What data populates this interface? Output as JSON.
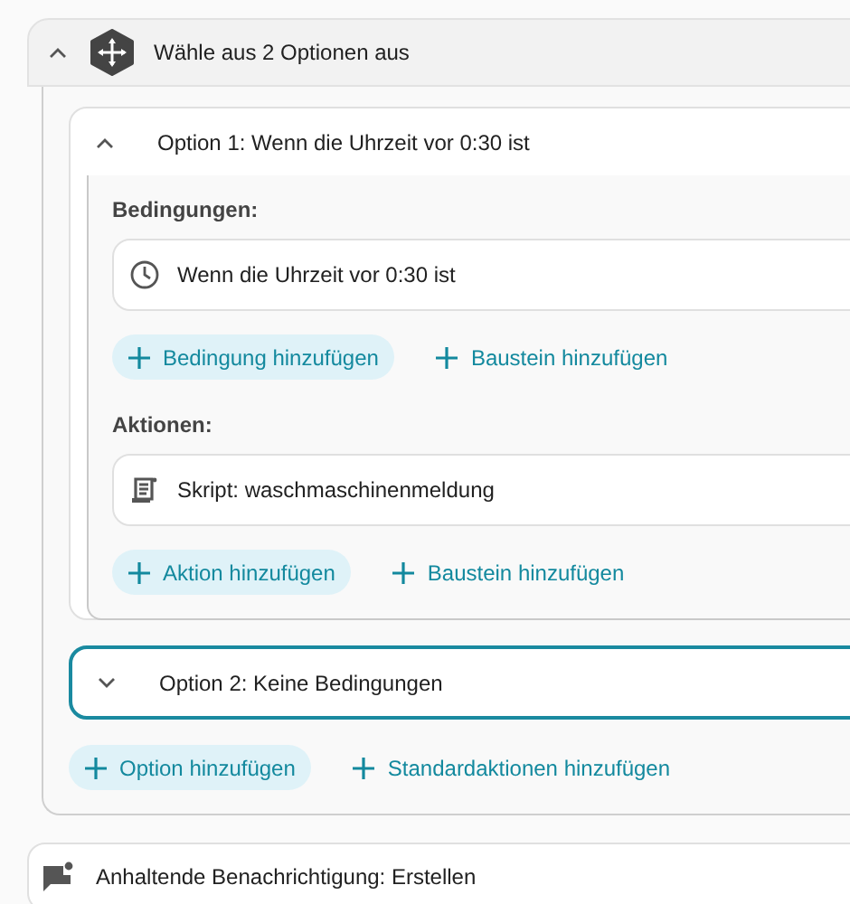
{
  "block": {
    "title": "Wähle aus 2 Optionen aus",
    "expanded": true,
    "options": [
      {
        "title": "Option 1: Wenn die Uhrzeit vor 0:30 ist",
        "expanded": true,
        "selected": false,
        "sections": [
          {
            "label": "Bedingungen:",
            "items": [
              {
                "kind": "time",
                "text": "Wenn die Uhrzeit vor 0:30 ist"
              }
            ],
            "buttons": [
              {
                "label": "Bedingung hinzufügen",
                "primary": true
              },
              {
                "label": "Baustein hinzufügen",
                "primary": false
              }
            ]
          },
          {
            "label": "Aktionen:",
            "items": [
              {
                "kind": "script",
                "text": "Skript: waschmaschinenmeldung"
              }
            ],
            "buttons": [
              {
                "label": "Aktion hinzufügen",
                "primary": true
              },
              {
                "label": "Baustein hinzufügen",
                "primary": false
              }
            ]
          }
        ]
      },
      {
        "title": "Option 2: Keine Bedingungen",
        "expanded": false,
        "selected": true
      }
    ],
    "buttons": [
      {
        "label": "Option hinzufügen",
        "primary": true
      },
      {
        "label": "Standardaktionen hinzufügen",
        "primary": false
      }
    ]
  },
  "next_action": {
    "kind": "notification",
    "text": "Anhaltende Benachrichtigung: Erstellen"
  }
}
